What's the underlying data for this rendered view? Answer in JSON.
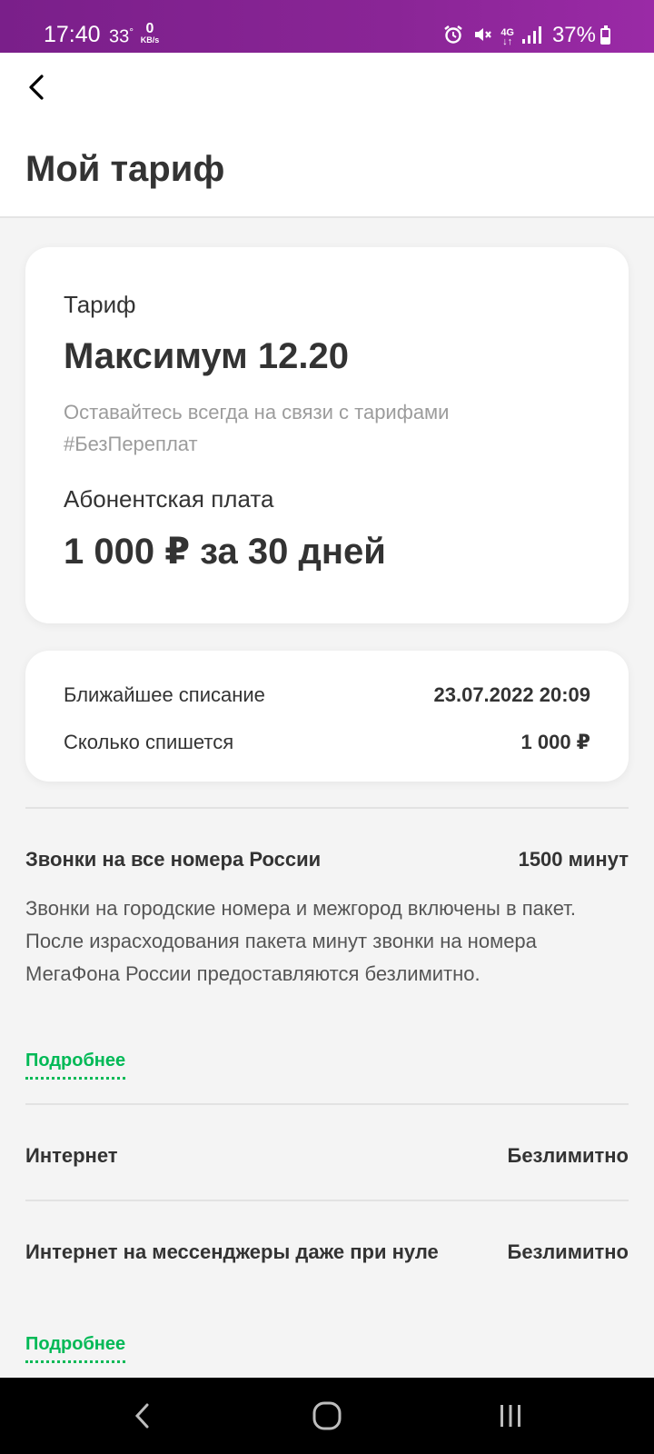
{
  "status_bar": {
    "time": "17:40",
    "temperature": "33",
    "degree": "°",
    "net_speed_value": "0",
    "net_speed_unit": "KB/s",
    "network_type": "4G",
    "battery": "37%",
    "icons": [
      "alarm-icon",
      "mute-icon",
      "4g-icon",
      "signal-icon",
      "battery-icon"
    ]
  },
  "header": {
    "title": "Мой тариф",
    "back_icon": "chevron-left-icon"
  },
  "tariff": {
    "label": "Тариф",
    "name": "Максимум 12.20",
    "description": "Оставайтесь всегда на связи с тарифами #БезПереплат",
    "fee_label": "Абонентская плата",
    "fee": "1 000 ₽ за 30 дней"
  },
  "billing": {
    "next_charge_label": "Ближайшее списание",
    "next_charge_value": "23.07.2022 20:09",
    "amount_label": "Сколько спишется",
    "amount_value": "1 000 ₽"
  },
  "features": [
    {
      "title": "Звонки на все номера России",
      "value": "1500 минут",
      "description": "Звонки на городские номера и межгород включены в пакет. После израсходования пакета минут звонки на номера МегаФона России предоставляются безлимитно.",
      "link": "Подробнее"
    },
    {
      "title": "Интернет",
      "value": "Безлимитно"
    },
    {
      "title": "Интернет на мессенджеры даже при нуле",
      "value": "Безлимитно",
      "link": "Подробнее"
    }
  ],
  "colors": {
    "status_bar": "#8a2596",
    "accent_green": "#00b956",
    "text": "#333333",
    "muted": "#9c9c9c"
  },
  "nav_bar": {
    "icons": [
      "back-icon",
      "home-icon",
      "recents-icon"
    ]
  }
}
